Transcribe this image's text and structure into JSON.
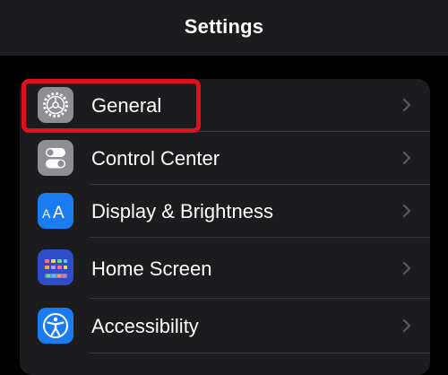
{
  "header": {
    "title": "Settings"
  },
  "settings": {
    "items": [
      {
        "label": "General",
        "icon": "gear-icon",
        "icon_color": "#8e8e93"
      },
      {
        "label": "Control Center",
        "icon": "toggles-icon",
        "icon_color": "#8e8e93"
      },
      {
        "label": "Display & Brightness",
        "icon": "text-size-icon",
        "icon_color": "#1a7cf0"
      },
      {
        "label": "Home Screen",
        "icon": "app-grid-icon",
        "icon_color": "#2f4cc9"
      },
      {
        "label": "Accessibility",
        "icon": "accessibility-icon",
        "icon_color": "#1a7cf0"
      }
    ]
  },
  "colors": {
    "background": "#000000",
    "group_background": "#1c1c1e",
    "highlight": "#e0101a",
    "chevron": "#5a5a5f"
  }
}
